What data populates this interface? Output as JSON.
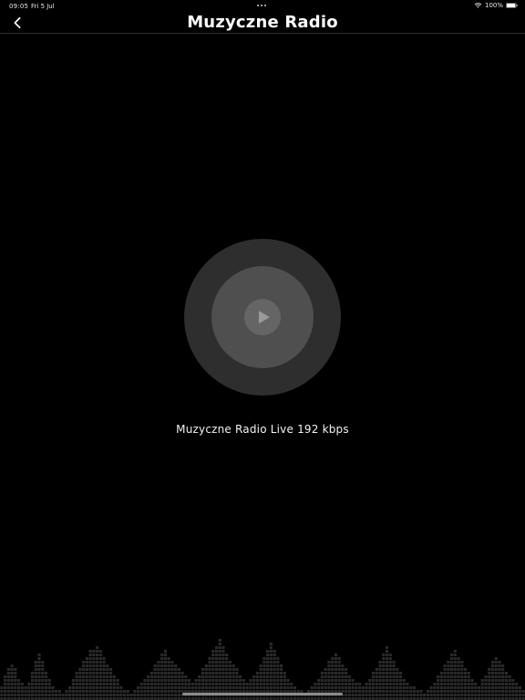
{
  "status_bar": {
    "time": "09:05",
    "date": "Fri 5 Jul",
    "battery": "100%",
    "wifi_icon": "wifi-icon",
    "battery_icon": "battery-icon"
  },
  "nav": {
    "title": "Muzyczne Radio",
    "back_icon": "chevron-left-icon"
  },
  "player": {
    "play_icon": "play-icon",
    "station_label": "Muzyczne Radio Live 192 kbps"
  },
  "colors": {
    "background": "#000000",
    "outer_ring": "#2e2e2e",
    "inner_ring": "#4f4f4f",
    "play_button": "#656565",
    "equalizer": "#2a2a2a"
  },
  "equalizer": {
    "levels": [
      0.18,
      0.28,
      0.36,
      0.42,
      0.36,
      0.26,
      0.2,
      0.16,
      0.22,
      0.34,
      0.46,
      0.54,
      0.46,
      0.34,
      0.24,
      0.18,
      0.14,
      0.12,
      0.1,
      0.12,
      0.16,
      0.24,
      0.32,
      0.38,
      0.44,
      0.5,
      0.56,
      0.58,
      0.62,
      0.56,
      0.48,
      0.42,
      0.36,
      0.3,
      0.24,
      0.18,
      0.14,
      0.12,
      0.1,
      0.12,
      0.16,
      0.2,
      0.24,
      0.28,
      0.34,
      0.4,
      0.46,
      0.52,
      0.56,
      0.5,
      0.44,
      0.4,
      0.36,
      0.32,
      0.28,
      0.26,
      0.22,
      0.26,
      0.3,
      0.36,
      0.42,
      0.48,
      0.56,
      0.62,
      0.7,
      0.62,
      0.54,
      0.46,
      0.4,
      0.36,
      0.3,
      0.24,
      0.2,
      0.24,
      0.28,
      0.34,
      0.4,
      0.48,
      0.58,
      0.66,
      0.58,
      0.48,
      0.4,
      0.32,
      0.26,
      0.2,
      0.16,
      0.14,
      0.12,
      0.1,
      0.12,
      0.16,
      0.2,
      0.26,
      0.32,
      0.38,
      0.44,
      0.5,
      0.54,
      0.48,
      0.42,
      0.36,
      0.3,
      0.26,
      0.22,
      0.2,
      0.18,
      0.22,
      0.26,
      0.32,
      0.38,
      0.46,
      0.54,
      0.6,
      0.54,
      0.46,
      0.38,
      0.32,
      0.26,
      0.22,
      0.18,
      0.16,
      0.14,
      0.12,
      0.1,
      0.14,
      0.18,
      0.22,
      0.28,
      0.34,
      0.4,
      0.46,
      0.52,
      0.56,
      0.5,
      0.44,
      0.38,
      0.32,
      0.26,
      0.22,
      0.18,
      0.24,
      0.3,
      0.36,
      0.44,
      0.5,
      0.46,
      0.4,
      0.34,
      0.28,
      0.24,
      0.2,
      0.16,
      0.12
    ]
  }
}
